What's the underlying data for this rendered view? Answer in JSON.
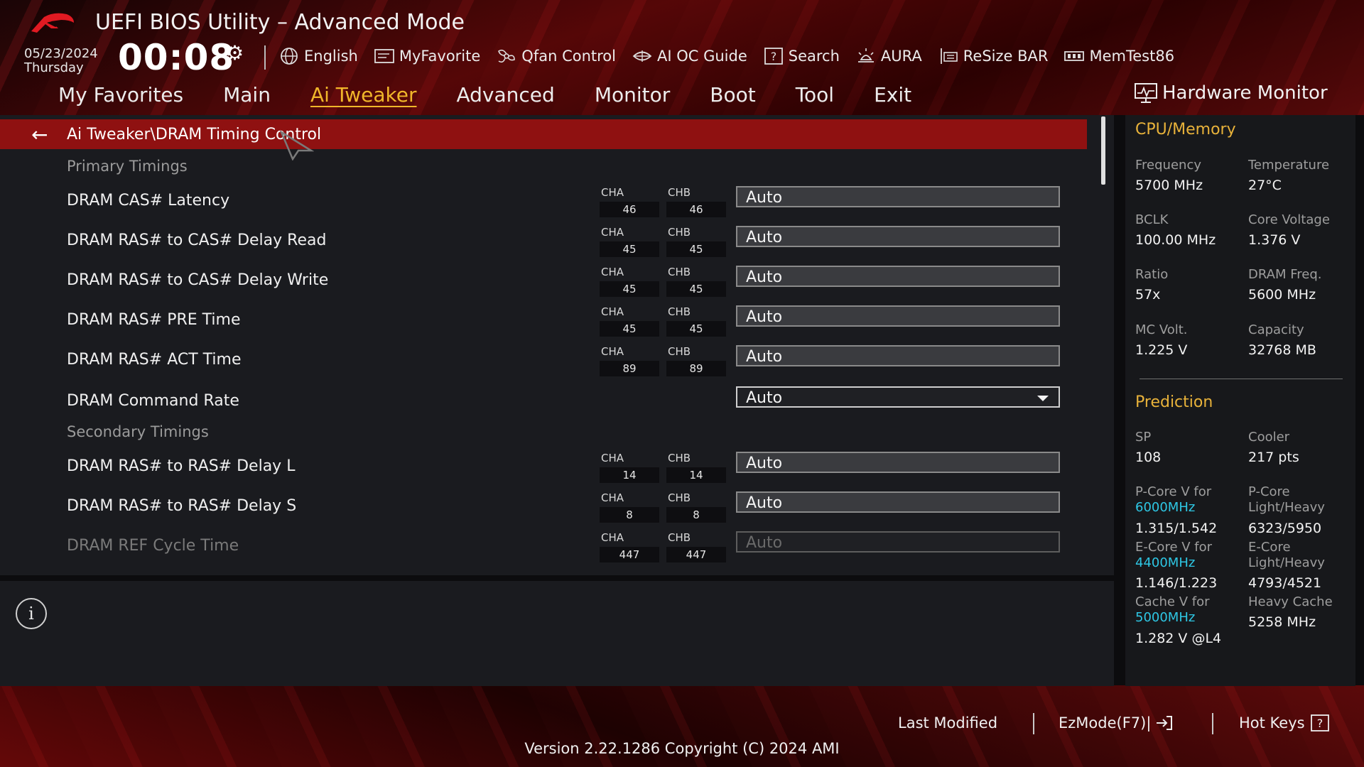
{
  "header": {
    "title": "UEFI BIOS Utility – Advanced Mode",
    "date": "05/23/2024",
    "day": "Thursday",
    "time": "00:08"
  },
  "toolbar": [
    {
      "label": "English",
      "icon": "globe-icon"
    },
    {
      "label": "MyFavorite",
      "icon": "favorite-icon"
    },
    {
      "label": "Qfan Control",
      "icon": "fan-icon"
    },
    {
      "label": "AI OC Guide",
      "icon": "oc-guide-icon"
    },
    {
      "label": "Search",
      "icon": "search-icon"
    },
    {
      "label": "AURA",
      "icon": "aura-icon"
    },
    {
      "label": "ReSize BAR",
      "icon": "resize-bar-icon"
    },
    {
      "label": "MemTest86",
      "icon": "memtest-icon"
    }
  ],
  "tabs": [
    "My Favorites",
    "Main",
    "Ai Tweaker",
    "Advanced",
    "Monitor",
    "Boot",
    "Tool",
    "Exit"
  ],
  "active_tab": "Ai Tweaker",
  "breadcrumb": "Ai Tweaker\\DRAM Timing Control",
  "sections": {
    "primary": "Primary Timings",
    "secondary": "Secondary Timings"
  },
  "rows": [
    {
      "label": "DRAM CAS# Latency",
      "cha_label": "CHA",
      "chb_label": "CHB",
      "cha": "46",
      "chb": "46",
      "value": "Auto"
    },
    {
      "label": "DRAM RAS# to CAS# Delay Read",
      "cha_label": "CHA",
      "chb_label": "CHB",
      "cha": "45",
      "chb": "45",
      "value": "Auto"
    },
    {
      "label": "DRAM RAS# to CAS# Delay Write",
      "cha_label": "CHA",
      "chb_label": "CHB",
      "cha": "45",
      "chb": "45",
      "value": "Auto"
    },
    {
      "label": "DRAM RAS# PRE Time",
      "cha_label": "CHA",
      "chb_label": "CHB",
      "cha": "45",
      "chb": "45",
      "value": "Auto"
    },
    {
      "label": "DRAM RAS# ACT Time",
      "cha_label": "CHA",
      "chb_label": "CHB",
      "cha": "89",
      "chb": "89",
      "value": "Auto"
    },
    {
      "label": "DRAM Command Rate",
      "value": "Auto"
    },
    {
      "label": "DRAM RAS# to RAS# Delay L",
      "cha_label": "CHA",
      "chb_label": "CHB",
      "cha": "14",
      "chb": "14",
      "value": "Auto"
    },
    {
      "label": "DRAM RAS# to RAS# Delay S",
      "cha_label": "CHA",
      "chb_label": "CHB",
      "cha": "8",
      "chb": "8",
      "value": "Auto"
    },
    {
      "label": "DRAM REF Cycle Time",
      "cha_label": "CHA",
      "chb_label": "CHB",
      "cha": "447",
      "chb": "447",
      "value": "Auto"
    }
  ],
  "hardware_monitor": {
    "title": "Hardware Monitor",
    "cpu_memory": {
      "heading": "CPU/Memory",
      "items": [
        {
          "label": "Frequency",
          "value": "5700 MHz"
        },
        {
          "label": "Temperature",
          "value": "27°C"
        },
        {
          "label": "BCLK",
          "value": "100.00 MHz"
        },
        {
          "label": "Core Voltage",
          "value": "1.376 V"
        },
        {
          "label": "Ratio",
          "value": "57x"
        },
        {
          "label": "DRAM Freq.",
          "value": "5600 MHz"
        },
        {
          "label": "MC Volt.",
          "value": "1.225 V"
        },
        {
          "label": "Capacity",
          "value": "32768 MB"
        }
      ]
    },
    "prediction": {
      "heading": "Prediction",
      "sp_label": "SP",
      "sp_value": "108",
      "cooler_label": "Cooler",
      "cooler_value": "217 pts",
      "pcore_label": "P-Core V for",
      "pcore_freq": "6000MHz",
      "pcore_value": "1.315/1.542",
      "pcore_lh_label1": "P-Core",
      "pcore_lh_label2": "Light/Heavy",
      "pcore_lh_value": "6323/5950",
      "ecore_label": "E-Core V for",
      "ecore_freq": "4400MHz",
      "ecore_value": "1.146/1.223",
      "ecore_lh_label1": "E-Core",
      "ecore_lh_label2": "Light/Heavy",
      "ecore_lh_value": "4793/4521",
      "cache_label": "Cache V for",
      "cache_freq": "5000MHz",
      "cache_value": "1.282 V @L4",
      "heavy_cache_label": "Heavy Cache",
      "heavy_cache_value": "5258 MHz"
    }
  },
  "footer": {
    "last_modified": "Last Modified",
    "ezmode": "EzMode(F7)|",
    "hotkeys": "Hot Keys",
    "version": "Version 2.22.1286 Copyright (C) 2024 AMI"
  },
  "colors": {
    "accent": "#f0b62a",
    "pathbar": "#8f1111",
    "highlight": "#2ec7e4"
  }
}
